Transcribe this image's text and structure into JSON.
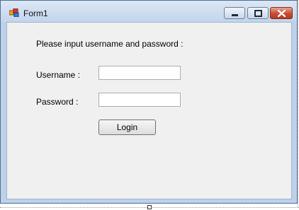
{
  "window": {
    "title": "Form1",
    "controls": {
      "minimize_icon": "minimize-icon",
      "maximize_icon": "maximize-icon",
      "close_icon": "close-icon"
    },
    "colors": {
      "titlebar": "#c2d5ec",
      "client_background": "#f0f0f0",
      "close_button": "#c94a32"
    }
  },
  "form": {
    "prompt": "Please input username and password :",
    "username_label": "Username :",
    "username_value": "",
    "password_label": "Password :",
    "password_value": "",
    "login_label": "Login"
  }
}
